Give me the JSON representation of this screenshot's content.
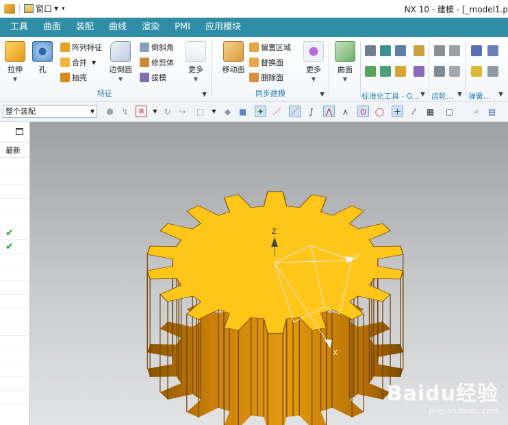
{
  "titlebar": {
    "window_menu": "窗口",
    "title": "NX 10 - 建模 - [_model1.p"
  },
  "menu": {
    "tabs": [
      "工具",
      "曲面",
      "装配",
      "曲线",
      "渲染",
      "PMI",
      "应用模块"
    ]
  },
  "ribbon": {
    "feature_group": {
      "label": "特征",
      "extrude": "拉伸",
      "hole": "孔",
      "pattern": "阵列特征",
      "unite": "合并",
      "shell": "抽壳",
      "edge_blend": "边倒圆",
      "chamfer": "倒斜角",
      "trim_body": "修剪体",
      "draft": "拔模",
      "more": "更多"
    },
    "sync_group": {
      "label": "同步建模",
      "move_face": "移动面",
      "offset_region": "偏置区域",
      "replace_face": "替换面",
      "delete_face": "删除面",
      "more": "更多"
    },
    "surface": "曲面",
    "std_tools_label": "标准化工具 - G...",
    "gear_label": "齿轮...",
    "spring_label": "弹簧..."
  },
  "toolbar": {
    "assembly_filter": "整个装配"
  },
  "navigator": {
    "column_header": "最新",
    "rows": [
      "",
      "",
      "",
      "",
      "",
      "✔",
      "✔",
      "",
      "",
      "",
      "",
      "",
      "",
      "",
      "",
      "",
      "",
      ""
    ]
  },
  "viewport": {
    "axis_z": "Z",
    "axis_y": "Y",
    "axis_x": "X",
    "watermark_brand": "Baidu经验",
    "watermark_url": "jingyan.baidu.com"
  },
  "colors": {
    "accent": "#2f8ea6",
    "gear_top": "#ffc61a",
    "gear_side": "#cf8a05",
    "group_label": "#2f7fb0",
    "check": "#1ea51e"
  }
}
